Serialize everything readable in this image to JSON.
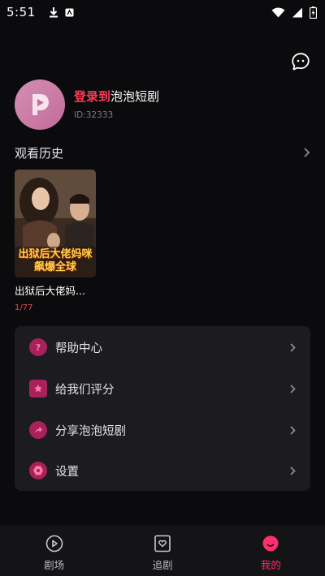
{
  "status_bar": {
    "time": "5:51",
    "icons": [
      "download-icon",
      "notification-icon",
      "wifi-icon",
      "signal-icon",
      "battery-charging-icon"
    ]
  },
  "header": {
    "chat_icon": "chat-bubble-icon"
  },
  "profile": {
    "login_prefix": "登录到",
    "app_name": "泡泡短剧",
    "user_id": "ID:32333",
    "avatar_icon": "app-logo-icon"
  },
  "history": {
    "title": "观看历史",
    "items": [
      {
        "title": "出狱后大佬妈...",
        "progress": "1/77",
        "poster_text": "出狱后大佬妈咪 飙爆全球"
      }
    ]
  },
  "menu": {
    "items": [
      {
        "label": "帮助中心",
        "icon": "question-icon"
      },
      {
        "label": "给我们评分",
        "icon": "star-icon"
      },
      {
        "label": "分享泡泡短剧",
        "icon": "share-icon"
      },
      {
        "label": "设置",
        "icon": "settings-icon"
      }
    ]
  },
  "bottom_nav": {
    "tabs": [
      {
        "label": "剧场",
        "icon": "theater-play-icon",
        "active": false
      },
      {
        "label": "追剧",
        "icon": "heart-bookmark-icon",
        "active": false
      },
      {
        "label": "我的",
        "icon": "profile-face-icon",
        "active": true
      }
    ]
  },
  "colors": {
    "accent": "#ff2f6e",
    "login_red": "#ff3b52",
    "menu_icon_bg": "#a8215a",
    "panel_bg": "#1c1c20"
  }
}
